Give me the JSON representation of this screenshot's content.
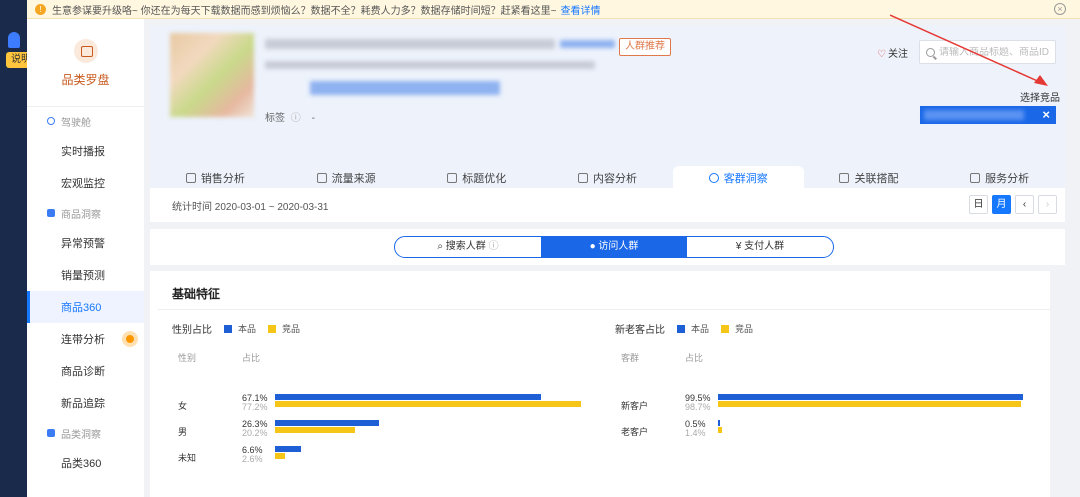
{
  "sidebar_toggle_label": "说明",
  "notice": {
    "text": "生意参谋要升级咯~ 你还在为每天下载数据而感到烦恼么？数据不全？耗费人力多？数据存储时间短？赶紧看这里~",
    "link": "查看详情"
  },
  "sidebar": {
    "brand": "品类罗盘",
    "groups": [
      {
        "label": "驾驶舱",
        "items": [
          "实时播报",
          "宏观监控"
        ]
      },
      {
        "label": "商品洞察",
        "items": [
          "异常预警",
          "销量预测",
          "商品360",
          "连带分析",
          "商品诊断",
          "新品追踪"
        ]
      },
      {
        "label": "品类洞察",
        "items": [
          "品类360"
        ]
      }
    ],
    "active": "商品360"
  },
  "product": {
    "tag": "人群推荐",
    "labels_label": "标签",
    "labels_value": "-",
    "follow": "关注",
    "search_placeholder": "请输入商品标题、商品ID",
    "select_competitor": "选择竞品"
  },
  "tabs": [
    "销售分析",
    "流量来源",
    "标题优化",
    "内容分析",
    "客群洞察",
    "关联搭配",
    "服务分析"
  ],
  "active_tab": "客群洞察",
  "stat_time": "统计时间 2020-03-01 ~ 2020-03-31",
  "period": {
    "day": "日",
    "month": "月",
    "prev": "‹",
    "next": "›"
  },
  "crowd_segments": [
    "搜索人群",
    "访问人群",
    "支付人群"
  ],
  "active_segment": "访问人群",
  "basic": {
    "title": "基础特征",
    "legend_self": "本品",
    "legend_comp": "竞品",
    "colors": {
      "self": "#1f5fd6",
      "comp": "#f5c518"
    },
    "gender": {
      "title": "性别占比",
      "col_label": "性别",
      "col_value": "占比",
      "rows": [
        {
          "label": "女",
          "self": "67.1%",
          "comp": "77.2%",
          "self_frac": 0.671,
          "comp_frac": 0.772
        },
        {
          "label": "男",
          "self": "26.3%",
          "comp": "20.2%",
          "self_frac": 0.263,
          "comp_frac": 0.202
        },
        {
          "label": "未知",
          "self": "6.6%",
          "comp": "2.6%",
          "self_frac": 0.066,
          "comp_frac": 0.026
        }
      ]
    },
    "newold": {
      "title": "新老客占比",
      "col_label": "客群",
      "col_value": "占比",
      "rows": [
        {
          "label": "新客户",
          "self": "99.5%",
          "comp": "98.7%",
          "self_frac": 0.995,
          "comp_frac": 0.987
        },
        {
          "label": "老客户",
          "self": "0.5%",
          "comp": "1.4%",
          "self_frac": 0.005,
          "comp_frac": 0.014
        }
      ]
    }
  }
}
